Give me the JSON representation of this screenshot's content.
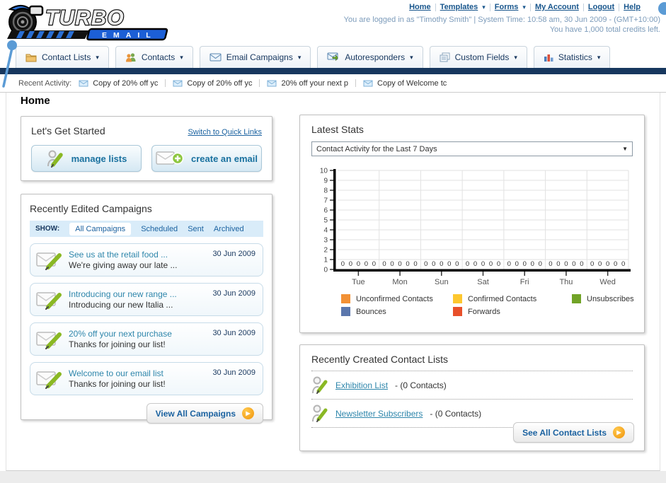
{
  "header": {
    "logo": {
      "line1": "TURBO",
      "line2": "EMAIL"
    },
    "nav": [
      {
        "label": "Home",
        "dropdown": false
      },
      {
        "label": "Templates",
        "dropdown": true
      },
      {
        "label": "Forms",
        "dropdown": true
      },
      {
        "label": "My Account",
        "dropdown": false
      },
      {
        "label": "Logout",
        "dropdown": false
      },
      {
        "label": "Help",
        "dropdown": false
      }
    ],
    "login_line": "You are logged in as \"Timothy Smith\" | System Time: 10:58 am, 30 Jun 2009 - (GMT+10:00)",
    "credits_line": "You have 1,000 total credits left."
  },
  "tabs": [
    {
      "label": "Contact Lists",
      "icon": "contact-lists-icon"
    },
    {
      "label": "Contacts",
      "icon": "contacts-icon"
    },
    {
      "label": "Email Campaigns",
      "icon": "email-campaigns-icon"
    },
    {
      "label": "Autoresponders",
      "icon": "autoresponders-icon"
    },
    {
      "label": "Custom Fields",
      "icon": "custom-fields-icon"
    },
    {
      "label": "Statistics",
      "icon": "statistics-icon"
    }
  ],
  "recent_activity": {
    "label": "Recent Activity:",
    "items": [
      "Copy of 20% off yc",
      "Copy of 20% off yc",
      "20% off your next p",
      "Copy of Welcome tc"
    ]
  },
  "page_title": "Home",
  "get_started": {
    "title": "Let's Get Started",
    "switch_link": "Switch to Quick Links",
    "manage_lists_label": "manage lists",
    "create_email_label": "create an email"
  },
  "campaigns": {
    "title": "Recently Edited Campaigns",
    "show_label": "SHOW:",
    "filters": [
      "All Campaigns",
      "Scheduled",
      "Sent",
      "Archived"
    ],
    "active_filter": "All Campaigns",
    "items": [
      {
        "title": "See us at the retail food ...",
        "subtitle": "We're giving away our late ...",
        "date": "30 Jun 2009"
      },
      {
        "title": "Introducing our new range ...",
        "subtitle": "Introducing our new Italia ...",
        "date": "30 Jun 2009"
      },
      {
        "title": "20% off your next purchase",
        "subtitle": "Thanks for joining our list!",
        "date": "30 Jun 2009"
      },
      {
        "title": "Welcome to our email list",
        "subtitle": "Thanks for joining our list!",
        "date": "30 Jun 2009"
      }
    ],
    "view_all_label": "View All Campaigns"
  },
  "stats": {
    "title": "Latest Stats",
    "dropdown_value": "Contact Activity for the Last 7 Days"
  },
  "chart_data": {
    "type": "bar",
    "title": "Contact Activity for the Last 7 Days",
    "categories": [
      "Tue",
      "Mon",
      "Sun",
      "Sat",
      "Fri",
      "Thu",
      "Wed"
    ],
    "series": [
      {
        "name": "Unconfirmed Contacts",
        "color": "#f29135",
        "values": [
          0,
          0,
          0,
          0,
          0,
          0,
          0
        ]
      },
      {
        "name": "Confirmed Contacts",
        "color": "#fdc72f",
        "values": [
          0,
          0,
          0,
          0,
          0,
          0,
          0
        ]
      },
      {
        "name": "Unsubscribes",
        "color": "#71a327",
        "values": [
          0,
          0,
          0,
          0,
          0,
          0,
          0
        ]
      },
      {
        "name": "Bounces",
        "color": "#5b77ad",
        "values": [
          0,
          0,
          0,
          0,
          0,
          0,
          0
        ]
      },
      {
        "name": "Forwards",
        "color": "#e8502a",
        "values": [
          0,
          0,
          0,
          0,
          0,
          0,
          0
        ]
      }
    ],
    "ylim": [
      0,
      10
    ],
    "ytick_step": 1,
    "grid": true,
    "legend_position": "bottom",
    "value_labels_shown": true
  },
  "contact_lists": {
    "title": "Recently Created Contact Lists",
    "items": [
      {
        "name": "Exhibition List",
        "detail": "- (0 Contacts)"
      },
      {
        "name": "Newsletter Subscribers",
        "detail": "- (0 Contacts)"
      }
    ],
    "see_all_label": "See All Contact Lists"
  },
  "icons": {
    "caret": "▾",
    "select_arrow": "▼",
    "arrow": "▶"
  },
  "colors": {
    "navy_bar": "#17375e",
    "link": "#1b62a0",
    "campaign_link": "#2e86ab",
    "go_button_orange": "#f0940a",
    "annotation_blue": "#5b9bd5"
  }
}
